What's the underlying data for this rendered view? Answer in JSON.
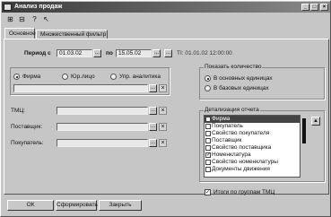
{
  "window": {
    "title": "Анализ продаж",
    "controls": [
      "_",
      "□",
      "×"
    ]
  },
  "toolbar": {
    "icons": [
      "toolbar-icon-1",
      "toolbar-icon-2",
      "toolbar-icon-3",
      "toolbar-icon-4"
    ]
  },
  "tabs": [
    {
      "label": "Основное"
    },
    {
      "label": "Множественный фильтр"
    }
  ],
  "period": {
    "label": "Период с",
    "from": "01.03.02",
    "to_label": "по",
    "to": "15.05.02",
    "ti_label": "ТІ: 01.01.02 12:00:00",
    "btn": "..."
  },
  "entity": {
    "options": [
      "Фирма",
      "Юр.лицо",
      "Упр. аналитика"
    ],
    "selected": "Фирма"
  },
  "filters": {
    "tmc": "ТМЦ:",
    "supplier": "Поставщик:",
    "buyer": "Покупатель:"
  },
  "show_qty": {
    "title": "Показать количество",
    "options": [
      "В основных единицах",
      "В базовых единицах"
    ],
    "selected": "В основных единицах"
  },
  "detail": {
    "title": "Детализация отчета",
    "items": [
      {
        "label": "Фирма",
        "checked": false,
        "selected": true
      },
      {
        "label": "Покупатель",
        "checked": false,
        "selected": false
      },
      {
        "label": "Свойство покупателя",
        "checked": false,
        "selected": false
      },
      {
        "label": "Поставщик",
        "checked": false,
        "selected": false
      },
      {
        "label": "Свойство поставщика",
        "checked": false,
        "selected": false
      },
      {
        "label": "Номенклатура",
        "checked": true,
        "selected": false
      },
      {
        "label": "Свойство номенклатуры",
        "checked": false,
        "selected": false
      },
      {
        "label": "Документы движения",
        "checked": false,
        "selected": false
      }
    ]
  },
  "totals": {
    "label": "Итоги по группам ТМЦ",
    "checked": true
  },
  "buttons": {
    "ok": "ОК",
    "build": "Сформировать",
    "close": "Закрыть"
  }
}
